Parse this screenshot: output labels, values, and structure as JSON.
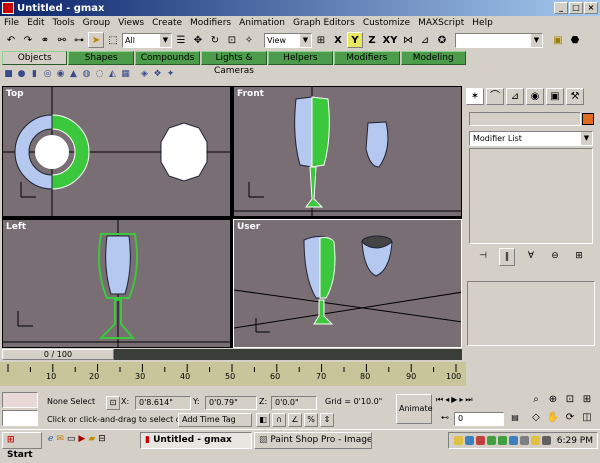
{
  "window": {
    "title": "Untitled - gmax",
    "controls": [
      "_",
      "□",
      "×"
    ]
  },
  "menu": [
    "File",
    "Edit",
    "Tools",
    "Group",
    "Views",
    "Create",
    "Modifiers",
    "Animation",
    "Graph Editors",
    "Customize",
    "MAXScript",
    "Help"
  ],
  "toolbar": {
    "selection_filter": "All",
    "reference_coord": "View",
    "axis_labels": [
      "X",
      "Y",
      "Z",
      "XY"
    ]
  },
  "tabs": [
    "Objects",
    "Shapes",
    "Compounds",
    "Lights & Cameras",
    "Helpers",
    "Modifiers",
    "Modeling"
  ],
  "viewports": {
    "top": "Top",
    "front": "Front",
    "left": "Left",
    "user": "User"
  },
  "command_panel": {
    "modifier_list": "Modifier List"
  },
  "time": {
    "slider": "0 / 100",
    "ticks": [
      "10",
      "20",
      "30",
      "40",
      "50",
      "60",
      "70",
      "80",
      "90",
      "100"
    ]
  },
  "status": {
    "selection": "None Select",
    "prompt": "Click or click-and-drag to select obje",
    "x_label": "X:",
    "x_value": "0'8.614\"",
    "y_label": "Y:",
    "y_value": "0'0.79\"",
    "z_label": "Z:",
    "z_value": "0'0.0\"",
    "grid": "Grid = 0'10.0\"",
    "add_time_tag": "Add Time Tag",
    "animate": "Animate",
    "frame": "0"
  },
  "taskbar": {
    "start": "Start",
    "tasks": [
      "Untitled - gmax",
      "Paint Shop Pro - Image8"
    ],
    "clock": "6:29 PM"
  },
  "colors": {
    "viewport_bg": "#786e73",
    "object_blue": "#b4c8f0",
    "selected_green": "#3cc83c",
    "tab_green": "#4c9c4c",
    "trackbar": "#c9c59a"
  }
}
